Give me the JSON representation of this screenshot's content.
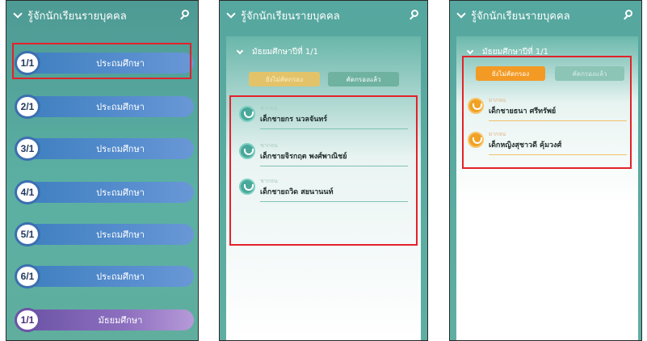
{
  "app": {
    "title": "รู้จักนักเรียนรายบุคคล"
  },
  "screen1": {
    "rows": [
      {
        "badge": "1/1",
        "label": "ประถมศึกษา"
      },
      {
        "badge": "2/1",
        "label": "ประถมศึกษา"
      },
      {
        "badge": "3/1",
        "label": "ประถมศึกษา"
      },
      {
        "badge": "4/1",
        "label": "ประถมศึกษา"
      },
      {
        "badge": "5/1",
        "label": "ประถมศึกษา"
      },
      {
        "badge": "6/1",
        "label": "ประถมศึกษา"
      },
      {
        "badge": "1/1",
        "label": "มัธยมศึกษา"
      }
    ]
  },
  "screen2": {
    "panel_title": "มัธยมศึกษาปีที่ 1/1",
    "tabs": {
      "pending": "ยังไม่คัดกรอง",
      "done": "คัดกรองแล้ว"
    },
    "students": [
      {
        "label": "ชากจน",
        "name": "เด็กชายกร นวลจันทร์"
      },
      {
        "label": "ชากจน",
        "name": "เด็กชายจิรกฤต พงศ์พาณิชย์"
      },
      {
        "label": "ชากจน",
        "name": "เด็กชายถวิด สยนานนท์"
      }
    ]
  },
  "screen3": {
    "panel_title": "มัธยมศึกษาปีที่ 1/1",
    "tabs": {
      "pending": "ยังไม่คัดกรอง",
      "done": "คัดกรองแล้ว"
    },
    "students": [
      {
        "label": "ยากจน",
        "name": "เด็กชายธนา ศรีทรัพย์"
      },
      {
        "label": "ยากจน",
        "name": "เด็กหญิงสุชาวดี คุ้มวงศ์"
      }
    ]
  },
  "colors": {
    "teal": "#5bb0a3",
    "blue_pill": "#4e86c8",
    "purple_pill": "#7b5fb3",
    "orange": "#f39a24",
    "highlight": "#e3222a"
  }
}
